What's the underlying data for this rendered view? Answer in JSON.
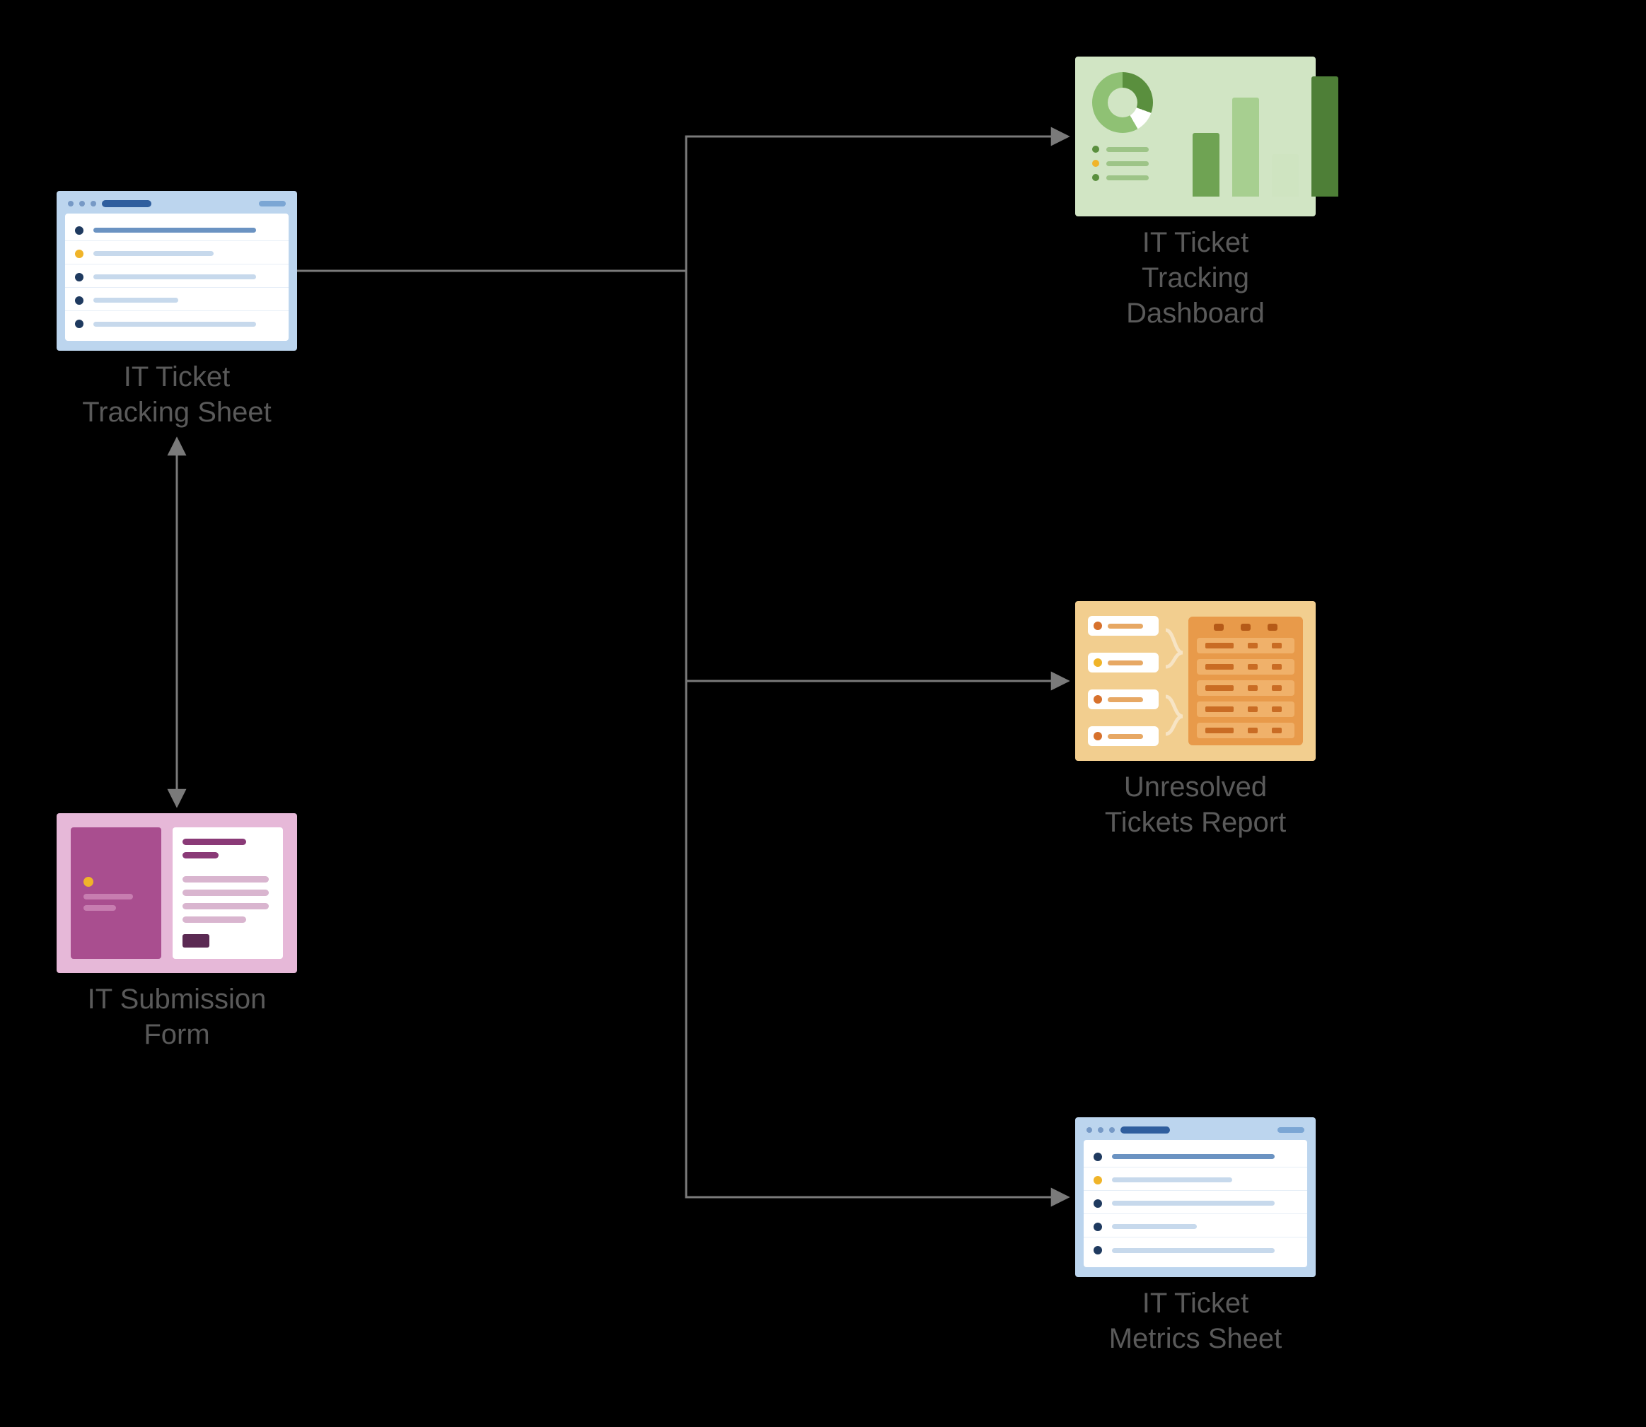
{
  "nodes": {
    "tracking_sheet": {
      "label": "IT Ticket\nTracking Sheet"
    },
    "submission_form": {
      "label": "IT Submission\nForm"
    },
    "dashboard": {
      "label": "IT Ticket\nTracking\nDashboard"
    },
    "report": {
      "label": "Unresolved\nTickets Report"
    },
    "metrics_sheet": {
      "label": "IT Ticket\nMetrics Sheet"
    }
  },
  "connections": [
    {
      "from": "tracking_sheet",
      "to": "dashboard",
      "directed": true
    },
    {
      "from": "tracking_sheet",
      "to": "report",
      "directed": true
    },
    {
      "from": "tracking_sheet",
      "to": "metrics_sheet",
      "directed": true
    },
    {
      "from": "tracking_sheet",
      "to": "submission_form",
      "bidirectional": true
    }
  ]
}
